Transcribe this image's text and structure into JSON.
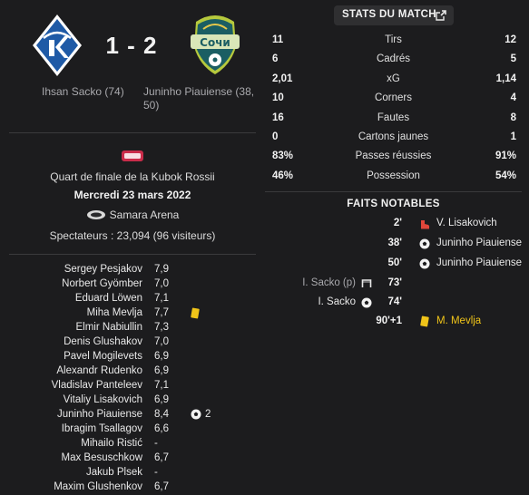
{
  "match": {
    "home_score": "1 - 2",
    "home_scorers": "Ihsan Sacko (74)",
    "away_scorers": "Juninho Piauiense (38, 50)",
    "competition": "Quart de finale de la Kubok Rossii",
    "date": "Mercredi 23 mars 2022",
    "stadium": "Samara Arena",
    "attendance": "Spectateurs : 23,094 (96 visiteurs)"
  },
  "ratings": [
    {
      "name": "Sergey Pesjakov",
      "rating": "7,9",
      "icon": ""
    },
    {
      "name": "Norbert Gyömber",
      "rating": "7,0",
      "icon": ""
    },
    {
      "name": "Eduard Löwen",
      "rating": "7,1",
      "icon": ""
    },
    {
      "name": "Miha Mevlja",
      "rating": "7,7",
      "icon": "yellow-card-icon"
    },
    {
      "name": "Elmir Nabiullin",
      "rating": "7,3",
      "icon": ""
    },
    {
      "name": "Denis Glushakov",
      "rating": "7,0",
      "icon": ""
    },
    {
      "name": "Pavel Mogilevets",
      "rating": "6,9",
      "icon": ""
    },
    {
      "name": "Alexandr Rudenko",
      "rating": "6,9",
      "icon": ""
    },
    {
      "name": "Vladislav Panteleev",
      "rating": "7,1",
      "icon": ""
    },
    {
      "name": "Vitaliy Lisakovich",
      "rating": "6,9",
      "icon": ""
    },
    {
      "name": "Juninho Piauiense",
      "rating": "8,4",
      "icon": "ball-icon",
      "goals": "2"
    },
    {
      "name": "Ibragim Tsallagov",
      "rating": "6,6",
      "icon": ""
    },
    {
      "name": "Mihailo Ristić",
      "rating": "-",
      "icon": ""
    },
    {
      "name": "Max Besuschkow",
      "rating": "6,7",
      "icon": ""
    },
    {
      "name": "Jakub Plsek",
      "rating": "-",
      "icon": ""
    },
    {
      "name": "Maxim Glushenkov",
      "rating": "6,7",
      "icon": ""
    }
  ],
  "stats_button": {
    "label": "STATS DU MATCH",
    "icon": "expand-icon"
  },
  "stats": [
    {
      "home": "11",
      "label": "Tirs",
      "away": "12"
    },
    {
      "home": "6",
      "label": "Cadrés",
      "away": "5"
    },
    {
      "home": "2,01",
      "label": "xG",
      "away": "1,14"
    },
    {
      "home": "10",
      "label": "Corners",
      "away": "4"
    },
    {
      "home": "16",
      "label": "Fautes",
      "away": "8"
    },
    {
      "home": "0",
      "label": "Cartons jaunes",
      "away": "1"
    },
    {
      "home": "83%",
      "label": "Passes réussies",
      "away": "91%"
    },
    {
      "home": "46%",
      "label": "Possession",
      "away": "54%"
    }
  ],
  "events_title": "FAITS NOTABLES",
  "events": [
    {
      "minute": "2'",
      "side": "away",
      "player": "V. Lisakovich",
      "icon": "assist-boot-icon"
    },
    {
      "minute": "38'",
      "side": "away",
      "player": "Juninho Piauiense",
      "icon": "ball-icon"
    },
    {
      "minute": "50'",
      "side": "away",
      "player": "Juninho Piauiense",
      "icon": "ball-icon"
    },
    {
      "minute": "73'",
      "side": "home",
      "player": "I. Sacko (p)",
      "icon": "missed-penalty-icon"
    },
    {
      "minute": "74'",
      "side": "home",
      "player": "I. Sacko",
      "icon": "ball-icon"
    },
    {
      "minute": "90'+1",
      "side": "away",
      "player": "M. Mevlja",
      "icon": "yellow-card-icon"
    }
  ],
  "colors": {
    "background": "#1c1c1e",
    "home_blue": "#1f5aa6",
    "away_teal": "#1b5e63",
    "yellow_card": "#f0c419",
    "accent_red": "#e0463a"
  }
}
